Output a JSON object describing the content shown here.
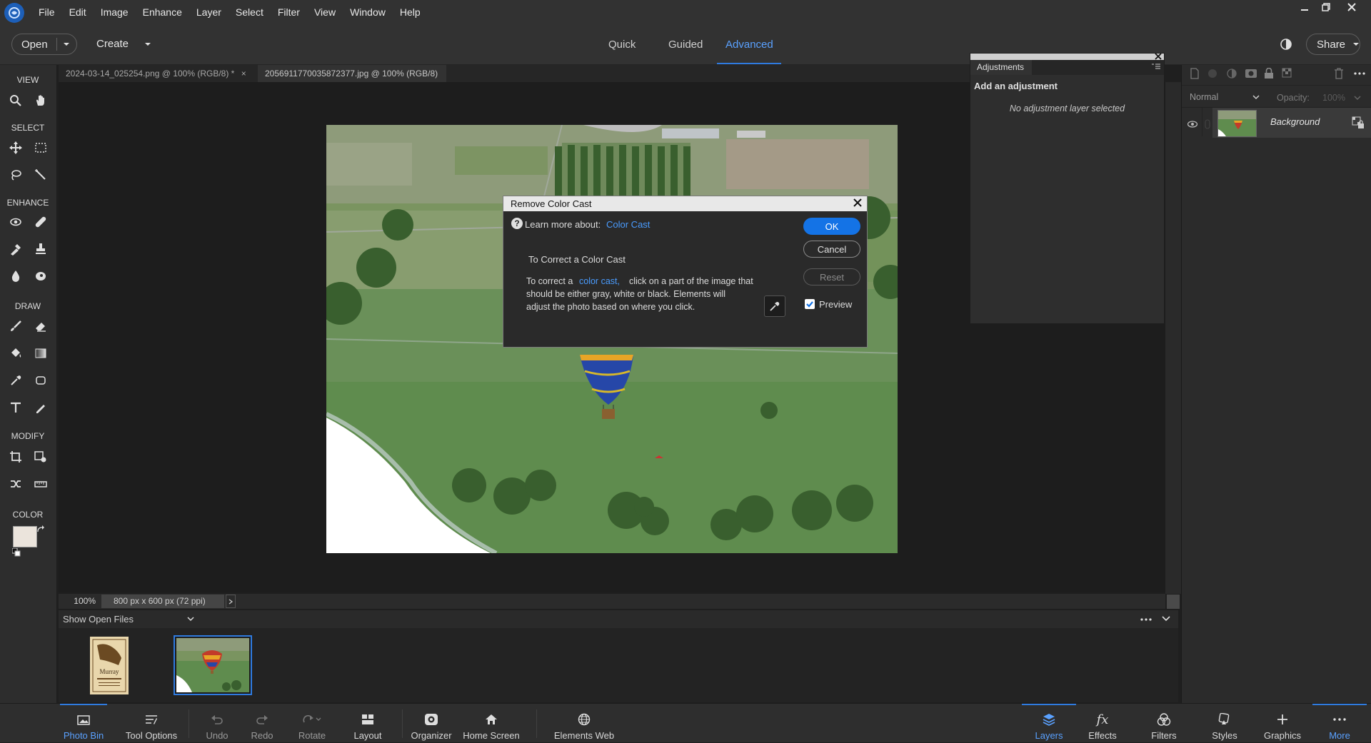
{
  "app": {
    "name": "Adobe Photoshop Elements"
  },
  "menubar": {
    "items": [
      "File",
      "Edit",
      "Image",
      "Enhance",
      "Layer",
      "Select",
      "Filter",
      "View",
      "Window",
      "Help"
    ]
  },
  "window_controls": {
    "minimize": "minimize-icon",
    "restore": "restore-icon",
    "close": "close-icon"
  },
  "toolbar": {
    "open_label": "Open",
    "create_label": "Create",
    "modes": [
      "Quick",
      "Guided",
      "Advanced"
    ],
    "active_mode": "Advanced",
    "share_label": "Share"
  },
  "tools": {
    "sections": [
      "VIEW",
      "SELECT",
      "ENHANCE",
      "DRAW",
      "MODIFY",
      "COLOR"
    ]
  },
  "doc_tabs": [
    {
      "title": "2024-03-14_025254.png @ 100% (RGB/8) *",
      "close": "×"
    },
    {
      "title": "2056911770035872377.jpg @ 100% (RGB/8)",
      "close": "×"
    }
  ],
  "dialog": {
    "title": "Remove Color Cast",
    "learn_more_label": "Learn more about:",
    "learn_more_link": "Color Cast",
    "heading": "To Correct a Color Cast",
    "body_prefix": "To correct a",
    "body_link": "color cast,",
    "body_rest_1": "click on a part of the image that",
    "body_rest_2": "should be either gray, white or black. Elements will",
    "body_rest_3": "adjust the photo based on where you click.",
    "ok_label": "OK",
    "cancel_label": "Cancel",
    "reset_label": "Reset",
    "preview_label": "Preview",
    "preview_checked": true
  },
  "adjustments": {
    "tab_label": "Adjustments",
    "add_label": "Add an adjustment",
    "empty_label": "No adjustment layer selected"
  },
  "layers": {
    "blend_mode": "Normal",
    "opacity_label": "Opacity:",
    "opacity_value": "100%",
    "layer_name": "Background"
  },
  "status": {
    "zoom": "100%",
    "doc_info": "800 px x 600 px (72 ppi)"
  },
  "bin": {
    "show_label": "Show Open Files"
  },
  "bottom_bar": {
    "photo_bin": "Photo Bin",
    "tool_options": "Tool Options",
    "undo": "Undo",
    "redo": "Redo",
    "rotate": "Rotate",
    "layout": "Layout",
    "organizer": "Organizer",
    "home_screen": "Home Screen",
    "elements_web": "Elements Web",
    "layers": "Layers",
    "effects": "Effects",
    "filters": "Filters",
    "styles": "Styles",
    "graphics": "Graphics",
    "more": "More"
  },
  "colors": {
    "accent": "#2f7be0",
    "ok_button": "#1473e6",
    "link": "#4a9cff"
  }
}
